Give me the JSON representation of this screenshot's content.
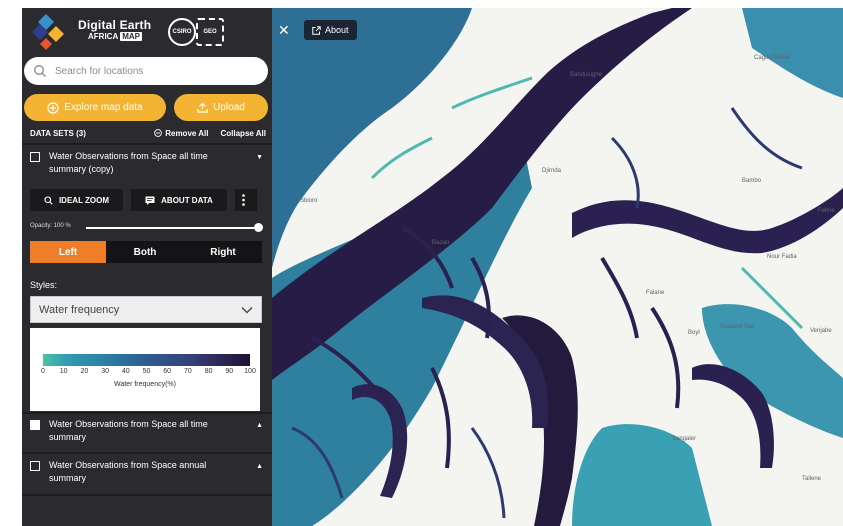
{
  "brand": {
    "title": "Digital Earth",
    "subtitle": "AFRICA",
    "badge": "MAP",
    "partners": [
      "CSIRO",
      "GEO"
    ]
  },
  "search": {
    "placeholder": "Search for locations",
    "value": ""
  },
  "actions": {
    "explore_label": "Explore map data",
    "upload_label": "Upload"
  },
  "datasets": {
    "header_label": "DATA SETS (3)",
    "remove_all_label": "Remove All",
    "collapse_all_label": "Collapse All",
    "items": [
      {
        "title": "Water Observations from Space all time summary (copy)",
        "checked": false,
        "expanded": true
      },
      {
        "title": "Water Observations from Space all time summary",
        "checked": true,
        "expanded": false
      },
      {
        "title": "Water Observations from Space annual summary",
        "checked": false,
        "expanded": false
      }
    ]
  },
  "layer_tools": {
    "ideal_zoom_label": "IDEAL ZOOM",
    "about_data_label": "ABOUT DATA",
    "more_icon": "vertical-dots-icon",
    "opacity_label": "Opacity: 100 %",
    "opacity_value": 1.0,
    "split_options": [
      "Left",
      "Both",
      "Right"
    ],
    "split_selected": "Left",
    "styles_label": "Styles:",
    "style_selected": "Water frequency"
  },
  "legend": {
    "ticks": [
      "0",
      "10",
      "20",
      "30",
      "40",
      "50",
      "60",
      "70",
      "80",
      "90",
      "100"
    ],
    "title": "Water frequency(%)"
  },
  "map": {
    "about_label": "About",
    "places": [
      "Cagoul Boker",
      "Bandiougne",
      "Djirnda",
      "Bambo",
      "Felme",
      "Nour Fadia",
      "Falane",
      "Boyl",
      "Soudem Sali",
      "Venjabe",
      "Sangaler",
      "Tallene",
      "Sbioro",
      "Baoan"
    ]
  },
  "colors": {
    "sidebar_bg": "#2b2b2f",
    "accent_yellow": "#f4b433",
    "accent_orange": "#f07e28",
    "water_dark": "#231a3d",
    "water_mid": "#2a5b8c",
    "water_light": "#3fa8b5",
    "land": "#f4f5f0"
  }
}
